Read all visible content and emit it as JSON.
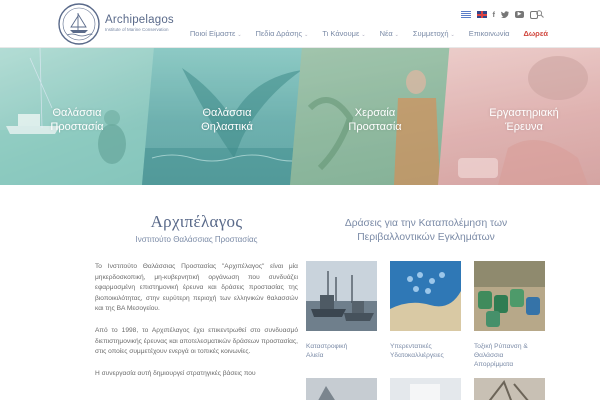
{
  "header": {
    "logo": {
      "name": "Archipelagos",
      "subtitle": "Institute of Marine Conservation"
    },
    "utility": {
      "flags": [
        "greek-flag-icon",
        "english-flag-icon"
      ],
      "social": [
        {
          "name": "facebook-icon",
          "glyph": "f"
        },
        {
          "name": "twitter-icon",
          "glyph": "t"
        },
        {
          "name": "youtube-icon",
          "glyph": "▶"
        },
        {
          "name": "instagram-icon",
          "glyph": ""
        }
      ],
      "search_icon": "search-icon"
    },
    "nav": [
      {
        "label": "Ποιοί Είμαστε",
        "has_dropdown": true
      },
      {
        "label": "Πεδία Δράσης",
        "has_dropdown": true
      },
      {
        "label": "Τι Κάνουμε",
        "has_dropdown": true
      },
      {
        "label": "Νέα",
        "has_dropdown": true
      },
      {
        "label": "Συμμετοχή",
        "has_dropdown": true
      },
      {
        "label": "Επικοινωνία",
        "has_dropdown": false
      },
      {
        "label": "Δωρεά",
        "has_dropdown": false
      }
    ],
    "accent": "#d0443b"
  },
  "hero": {
    "panels": [
      {
        "title_line1": "Θαλάσσια",
        "title_line2": "Προστασία"
      },
      {
        "title_line1": "Θαλάσσια",
        "title_line2": "Θηλαστικά"
      },
      {
        "title_line1": "Χερσαία",
        "title_line2": "Προστασία"
      },
      {
        "title_line1": "Εργαστηριακή",
        "title_line2": "Έρευνα"
      }
    ]
  },
  "intro": {
    "title": "Αρχιπέλαγος",
    "subtitle": "Ινστιτούτο Θαλάσσιας Προστασίας",
    "paragraphs": [
      "Το Ινστιτούτο Θαλάσσιας Προστασίας \"Αρχιπέλαγος\" είναι μία μηκερδοσκοπική, μη-κυβερνητική οργάνωση που συνδυάζει εφαρμοσμένη επιστημονική έρευνα και δράσεις προστασίας της βιοποικιλότητας, στην ευρύτερη περιοχή των ελληνικών θαλασσών και της ΒΑ Μεσογείου.",
      "Από το 1998, το Αρχιπέλαγος έχει επικεντρωθεί στο συνδυασμό διεπιστημονικής έρευνας και αποτελεσματικών δράσεων προστασίας, στις οποίες συμμετέχουν ενεργά οι τοπικές κοινωνίες.",
      "Η συνεργασία αυτή δημιουργεί στρατηγικές βάσεις που"
    ]
  },
  "actions": {
    "title_line1": "Δράσεις για την Καταπολέμηση των",
    "title_line2": "Περιβαλλοντικών Εγκλημάτων",
    "items": [
      {
        "line1": "Καταστροφική",
        "line2": "Αλιεία",
        "line3": ""
      },
      {
        "line1": "Υπερεντατικές",
        "line2": "Υδατοκαλλιέργειες",
        "line3": ""
      },
      {
        "line1": "Τοξική Ρύπανση &",
        "line2": "Θαλάσσια",
        "line3": "Απορρίμματα"
      }
    ]
  }
}
